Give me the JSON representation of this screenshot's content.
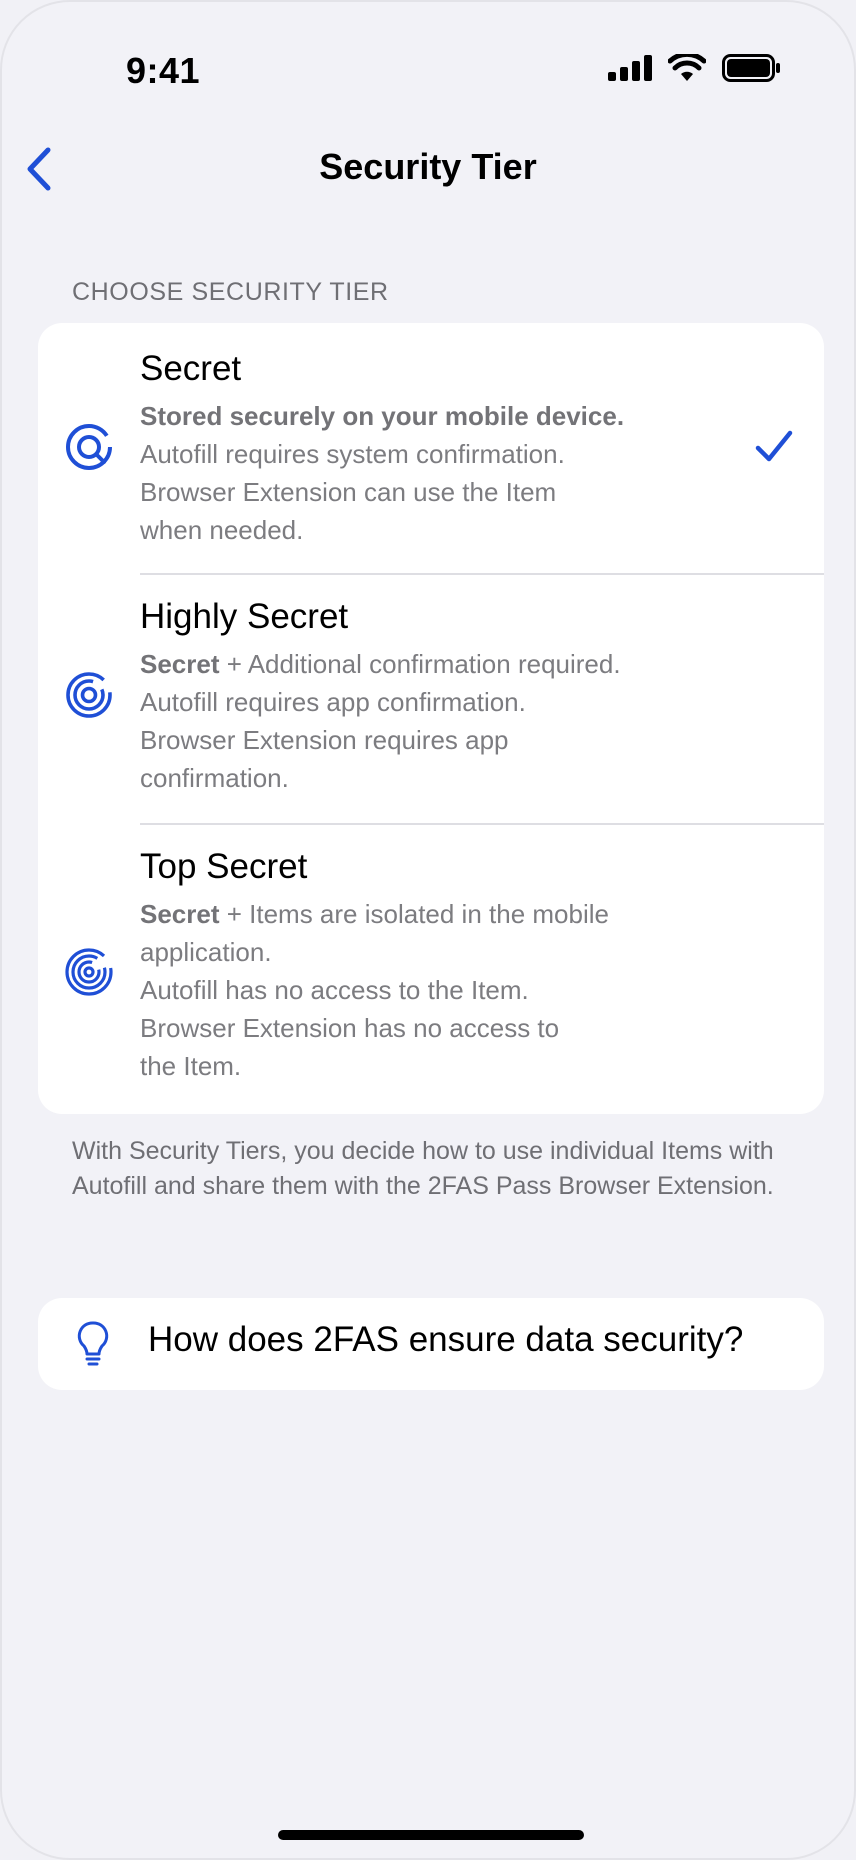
{
  "status_bar": {
    "time": "9:41"
  },
  "nav": {
    "title": "Security Tier",
    "back_icon": "chevron-left-icon"
  },
  "section": {
    "header": "CHOOSE SECURITY TIER"
  },
  "tiers": [
    {
      "title": "Secret",
      "bold_lead": "Stored securely on your mobile device.",
      "lead_rest": "",
      "lines": [
        "Autofill requires system confirmation.",
        "Browser Extension can use the Item",
        "when needed."
      ],
      "icon": "tier-secret-icon",
      "selected": true
    },
    {
      "title": "Highly Secret",
      "bold_lead": "Secret",
      "lead_rest": " + Additional confirmation required.",
      "lines": [
        "Autofill requires app confirmation.",
        "Browser Extension requires app",
        "confirmation."
      ],
      "icon": "tier-highly-secret-icon",
      "selected": false
    },
    {
      "title": "Top Secret",
      "bold_lead": "Secret",
      "lead_rest": " + Items are isolated in the mobile",
      "lines": [
        "application.",
        "Autofill has no access to the Item.",
        "Browser Extension has no access to",
        "the Item."
      ],
      "icon": "tier-top-secret-icon",
      "selected": false
    }
  ],
  "footer": {
    "text": "With Security Tiers, you decide how to use individual Items with Autofill and share them with the 2FAS Pass Browser Extension."
  },
  "help": {
    "label": "How does 2FAS ensure data security?",
    "icon": "lightbulb-icon"
  },
  "colors": {
    "accent": "#1f4fd6",
    "background": "#f2f2f7",
    "secondary_text": "#7c7c80"
  }
}
